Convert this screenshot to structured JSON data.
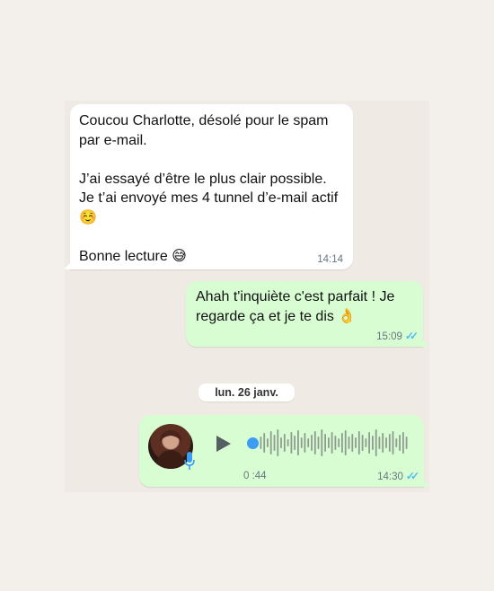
{
  "incoming_message": {
    "paragraphs": [
      "Coucou Charlotte, désolé pour le spam par e-mail.",
      "J’ai essayé d’être le plus clair possible. Je t’ai envoyé mes 4 tunnel d’e-mail actif ☺️",
      "Bonne lecture 😅"
    ],
    "time": "14:14"
  },
  "reply_message": {
    "text": "Ahah t'inquiète c'est parfait ! Je regarde ça et je te dis 👌",
    "time": "15:09",
    "status": "read"
  },
  "date_separator": "lun. 26 janv.",
  "voice_message": {
    "duration": "0 :44",
    "time": "14:30",
    "status": "read",
    "progress": 0.0
  },
  "colors": {
    "outgoing_bubble": "#d9fdd3",
    "incoming_bubble": "#ffffff",
    "read_ticks": "#53bdeb",
    "accent_blue": "#3b9cf2"
  },
  "icons": {
    "play": "play-icon",
    "mic": "mic-icon",
    "read": "double-check-icon"
  }
}
